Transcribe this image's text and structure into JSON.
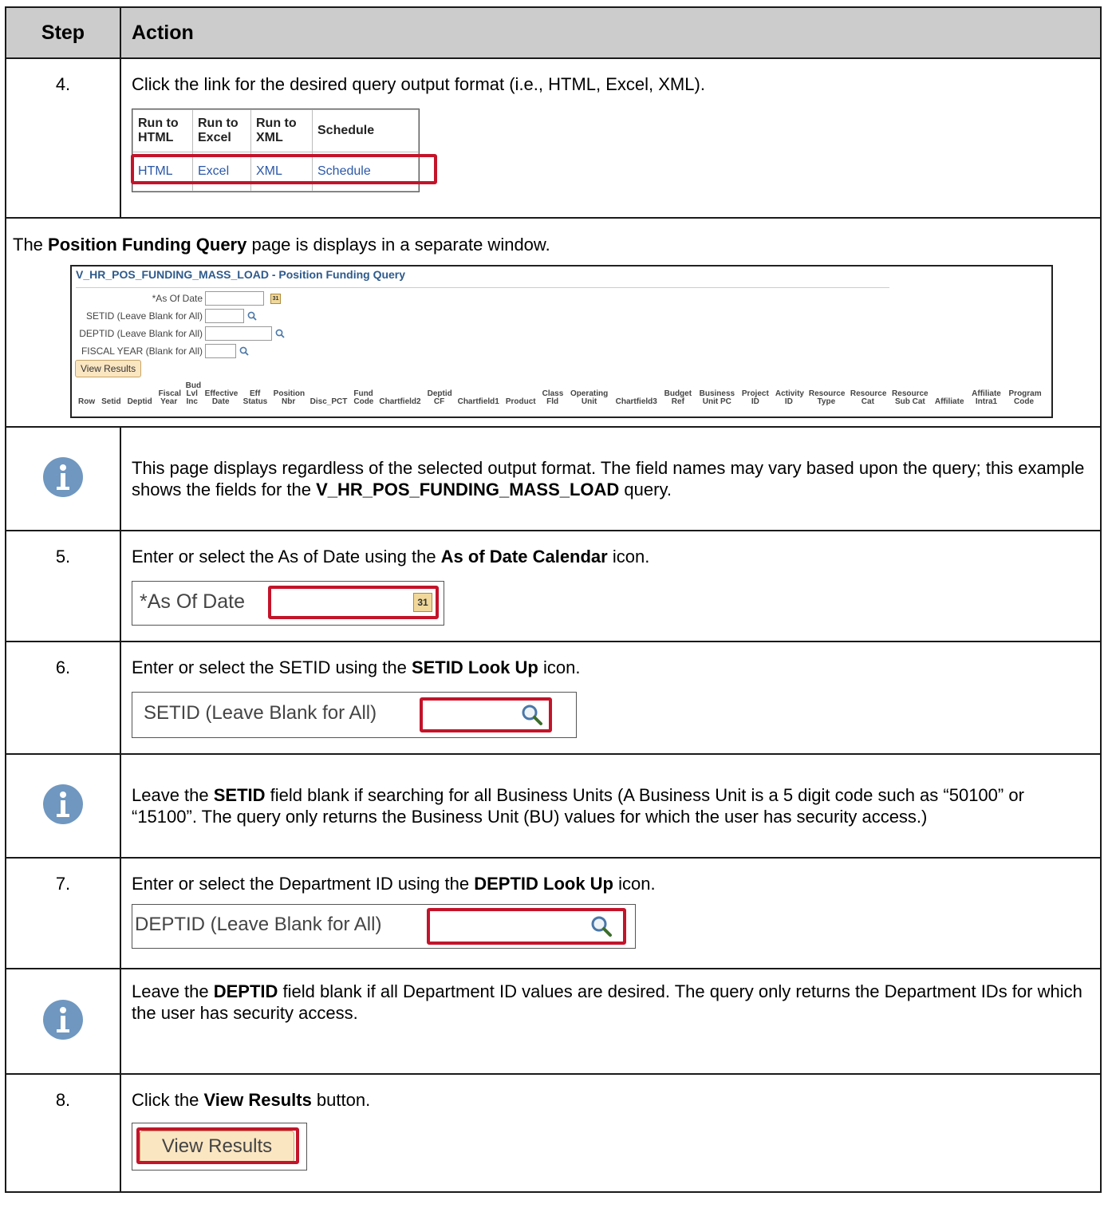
{
  "header": {
    "step": "Step",
    "action": "Action"
  },
  "step4": {
    "num": "4.",
    "text": "Click the link for the desired query output format (i.e., HTML, Excel, XML).",
    "headers": [
      "Run to HTML",
      "Run to Excel",
      "Run to XML",
      "Schedule"
    ],
    "links": [
      "HTML",
      "Excel",
      "XML",
      "Schedule"
    ]
  },
  "window_note": {
    "pre": "The ",
    "bold": "Position Funding Query",
    "post": " page is displays in a separate window."
  },
  "query": {
    "title": "V_HR_POS_FUNDING_MASS_LOAD - Position Funding Query",
    "as_of_date_label": "*As Of Date",
    "setid_label": "SETID (Leave Blank for All)",
    "deptid_label": "DEPTID (Leave Blank for All)",
    "fiscal_label": "FISCAL YEAR (Blank for All)",
    "view_results": "View Results",
    "columns": [
      "Row",
      "Setid",
      "Deptid",
      "Fiscal Year",
      "Bud Lvl Inc",
      "Effective Date",
      "Eff Status",
      "Position Nbr",
      "Disc_PCT",
      "Fund Code",
      "Chartfield2",
      "Deptid CF",
      "Chartfield1",
      "Product",
      "Class Fld",
      "Operating Unit",
      "Chartfield3",
      "Budget Ref",
      "Business Unit PC",
      "Project ID",
      "Activity ID",
      "Resource Type",
      "Resource Cat",
      "Resource Sub Cat",
      "Affiliate",
      "Affiliate Intra1",
      "Program Code"
    ]
  },
  "note1": {
    "line": "This page displays regardless of the selected output format.  The field names may vary based upon the query; this example shows the fields for the ",
    "bold": "V_HR_POS_FUNDING_MASS_LOAD",
    "post": " query."
  },
  "step5": {
    "num": "5.",
    "pre": "Enter or select the As of Date using the ",
    "bold": "As of Date Calendar",
    "post": " icon.",
    "label": "*As Of Date"
  },
  "step6": {
    "num": "6.",
    "pre": "Enter or select the SETID using the ",
    "bold": "SETID Look Up",
    "post": " icon.",
    "label": "SETID (Leave Blank for All)"
  },
  "note2": {
    "pre": "Leave the ",
    "bold": "SETID",
    "post": " field blank if searching for all Business Units (A Business Unit is a 5 digit code such as “50100” or “15100”.  The query only returns the Business Unit (BU) values for which the user has security access.)"
  },
  "step7": {
    "num": "7.",
    "pre": "Enter or select the Department ID using the ",
    "bold": "DEPTID Look Up",
    "post": " icon.",
    "label": "DEPTID (Leave Blank for All)"
  },
  "note3": {
    "pre": "Leave the ",
    "bold": "DEPTID",
    "post": " field blank if all Department ID values are desired.  The query only returns the Department IDs for which the user has security access."
  },
  "step8": {
    "num": "8.",
    "pre": "Click the ",
    "bold": "View Results",
    "post": " button.",
    "button": "View Results"
  },
  "icons": {
    "info": "info-icon",
    "calendar": "calendar-icon",
    "lookup": "magnifier-icon",
    "calendar_text": "31"
  }
}
